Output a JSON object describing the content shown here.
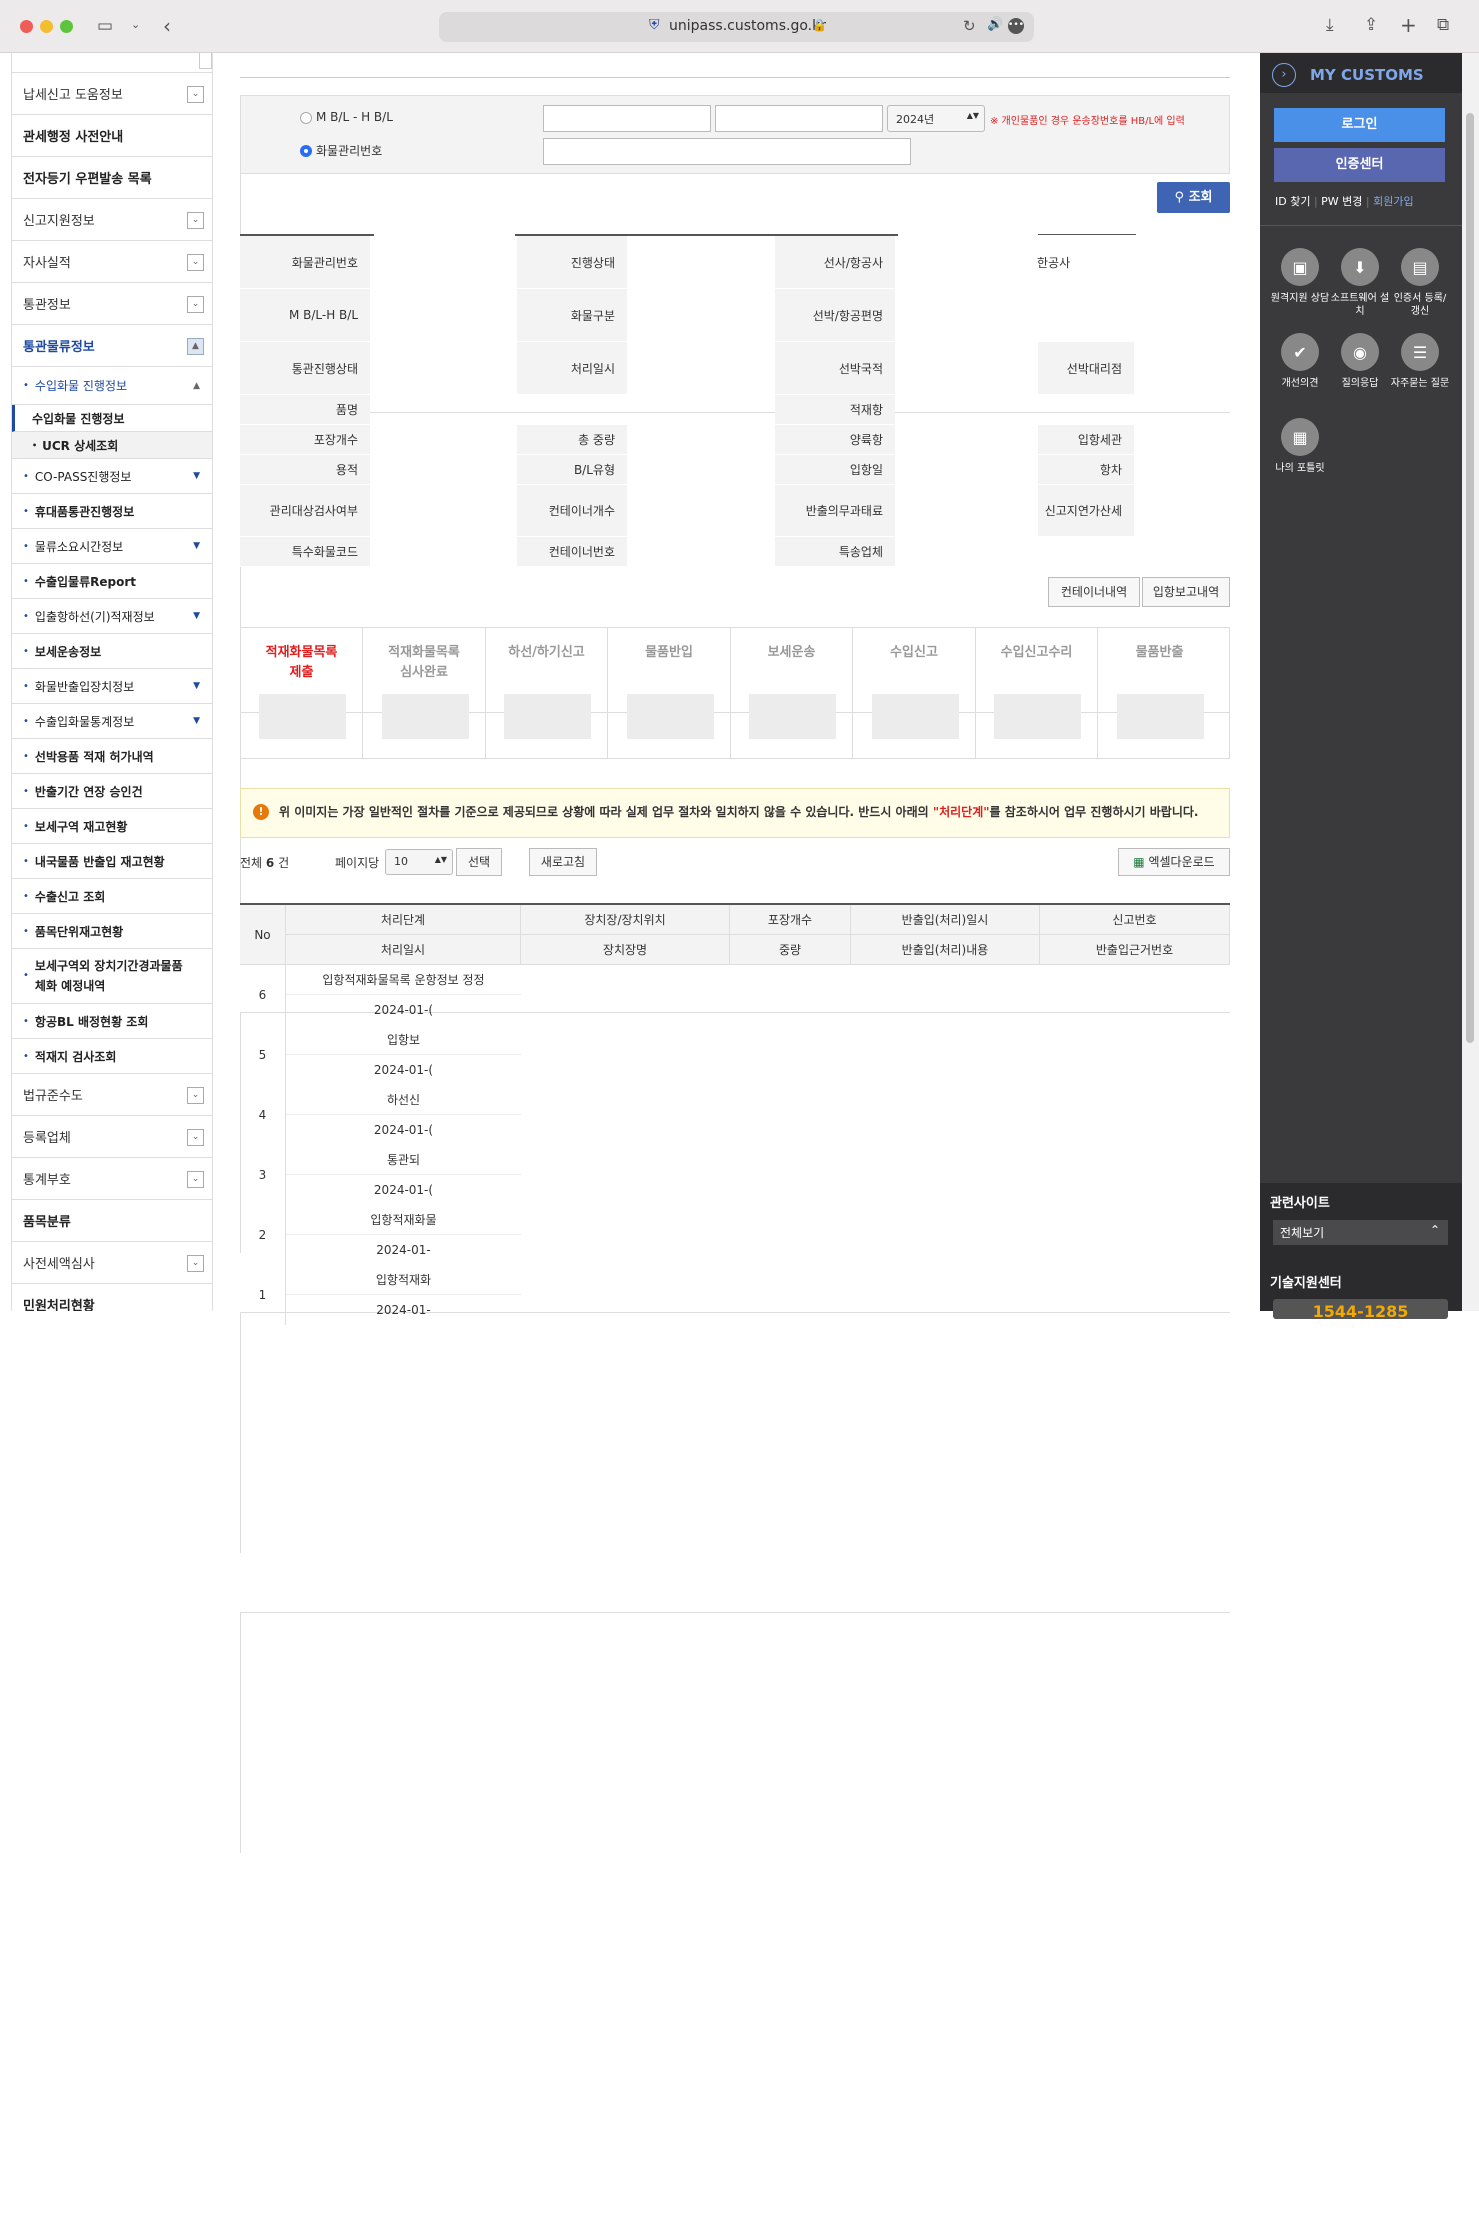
{
  "browser": {
    "url": "unipass.customs.go.kr"
  },
  "left_menu": {
    "top": [
      {
        "label": "납세신고 도움정보",
        "exp": true,
        "bold": false
      },
      {
        "label": "관세행정 사전안내",
        "exp": false,
        "bold": true
      },
      {
        "label": "전자등기 우편발송 목록",
        "exp": false,
        "bold": true
      },
      {
        "label": "신고지원정보",
        "exp": true,
        "bold": false
      },
      {
        "label": "자사실적",
        "exp": true,
        "bold": false
      },
      {
        "label": "통관정보",
        "exp": true,
        "bold": false
      }
    ],
    "active": "통관물류정보",
    "sub_active": "수입화물 진행정보",
    "subsub": [
      "수입화물 진행정보",
      "UCR 상세조회"
    ],
    "subs": [
      {
        "label": "CO-PASS진행정보",
        "arr": true
      },
      {
        "label": "휴대품통관진행정보",
        "arr": false
      },
      {
        "label": "물류소요시간정보",
        "arr": true
      },
      {
        "label": "수출입물류Report",
        "arr": false
      },
      {
        "label": "입출항하선(기)적재정보",
        "arr": true
      },
      {
        "label": "보세운송정보",
        "arr": false
      },
      {
        "label": "화물반출입장치정보",
        "arr": true
      },
      {
        "label": "수출입화물통계정보",
        "arr": true
      },
      {
        "label": "선박용품 적재 허가내역",
        "arr": false
      },
      {
        "label": "반출기간 연장 승인건",
        "arr": false
      },
      {
        "label": "보세구역 재고현황",
        "arr": false
      },
      {
        "label": "내국물품 반출입 재고현황",
        "arr": false
      },
      {
        "label": "수출신고 조회",
        "arr": false
      },
      {
        "label": "품목단위재고현황",
        "arr": false
      }
    ],
    "sub_tall": "보세구역외 장치기간경과물품 체화 예정내역",
    "subs2": [
      "항공BL 배정현황 조회",
      "적재지 검사조회"
    ],
    "bottom": [
      {
        "label": "법규준수도",
        "exp": true,
        "bold": false
      },
      {
        "label": "등록업체",
        "exp": true,
        "bold": false
      },
      {
        "label": "통계부호",
        "exp": true,
        "bold": false
      },
      {
        "label": "품목분류",
        "exp": false,
        "bold": true
      },
      {
        "label": "사전세액심사",
        "exp": true,
        "bold": false
      },
      {
        "label": "민원처리현황",
        "exp": false,
        "bold": true
      }
    ]
  },
  "search": {
    "radio1": "M B/L - H B/L",
    "radio2": "화물관리번호",
    "year": "2024년",
    "notice": "※ 개인물품인 경우 운송장번호를 HB/L에 입력",
    "button": "조회"
  },
  "info": {
    "col1": [
      "화물관리번호",
      "M B/L-H B/L",
      "통관진행상태",
      "품명",
      "포장개수",
      "용적",
      "관리대상검사여부",
      "특수화물코드"
    ],
    "col2": [
      "진행상태",
      "화물구분",
      "처리일시",
      "총 중량",
      "B/L유형",
      "컨테이너개수",
      "컨테이너번호"
    ],
    "col3": [
      "선사/항공사",
      "선박/항공편명",
      "선박국적",
      "적재항",
      "양륙항",
      "입항일",
      "반출의무과태료",
      "특송업체"
    ],
    "col4_value": "한공사",
    "col4": [
      "선박대리점",
      "입항세관",
      "항차",
      "신고지연가산세"
    ]
  },
  "btns": {
    "container": "컨테이너내역",
    "report": "입항보고내역"
  },
  "steps": [
    {
      "label": "적재화물목록제출",
      "active": true
    },
    {
      "label": "적재화물목록 심사완료",
      "active": false
    },
    {
      "label": "하선/하기신고",
      "active": false
    },
    {
      "label": "물품반입",
      "active": false
    },
    {
      "label": "보세운송",
      "active": false
    },
    {
      "label": "수입신고",
      "active": false
    },
    {
      "label": "수입신고수리",
      "active": false
    },
    {
      "label": "물품반출",
      "active": false
    }
  ],
  "notice": {
    "text": "위 이미지는 가장 일반적인 절차를 기준으로 제공되므로 상황에 따라 실제 업무 절차와 일치하지 않을 수 있습니다. 반드시 아래의 ",
    "highlight": "\"처리단계\"",
    "text2": "를 참조하시어 업무 진행하시기 바랍니다."
  },
  "list": {
    "total_prefix": "전체",
    "total": "6",
    "total_suffix": "건",
    "per_page_label": "페이지당",
    "per_page": "10",
    "select_btn": "선택",
    "refresh_btn": "새로고침",
    "excel_btn": "엑셀다운로드"
  },
  "table": {
    "head1": [
      "No",
      "처리단계",
      "장치장/장치위치",
      "포장개수",
      "반출입(처리)일시",
      "신고번호"
    ],
    "head2": [
      "처리일시",
      "장치장명",
      "중량",
      "반출입(처리)내용",
      "반출입근거번호"
    ],
    "rows": [
      {
        "no": "6",
        "step": "입항적재화물목록 운항정보 정정",
        "date": "2024-01-("
      },
      {
        "no": "5",
        "step": "입항보",
        "date": "2024-01-("
      },
      {
        "no": "4",
        "step": "하선신",
        "date": "2024-01-("
      },
      {
        "no": "3",
        "step": "통관되",
        "date": "2024-01-("
      },
      {
        "no": "2",
        "step": "입항적재화물",
        "date": "2024-01-"
      },
      {
        "no": "1",
        "step": "입항적재화",
        "date": "2024-01-"
      }
    ]
  },
  "right": {
    "title": "MY CUSTOMS",
    "login": "로그인",
    "cert": "인증센터",
    "id_find": "ID 찾기",
    "pw": "PW 변경",
    "join": "회원가입",
    "quick": [
      {
        "label": "원격지원 상담",
        "icon": "monitor-icon"
      },
      {
        "label": "소프트웨어 설치",
        "icon": "box-icon"
      },
      {
        "label": "인증서 등록/갱신",
        "icon": "certificate-icon"
      },
      {
        "label": "개선의견",
        "icon": "check-icon"
      },
      {
        "label": "질의응답",
        "icon": "qna-icon"
      },
      {
        "label": "자주묻는 질문",
        "icon": "faq-icon"
      },
      {
        "label": "나의 포틀릿",
        "icon": "calculator-icon"
      }
    ],
    "related": "관련사이트",
    "related_sel": "전체보기",
    "tech": "기술지원센터",
    "phone": "1544-1285"
  }
}
